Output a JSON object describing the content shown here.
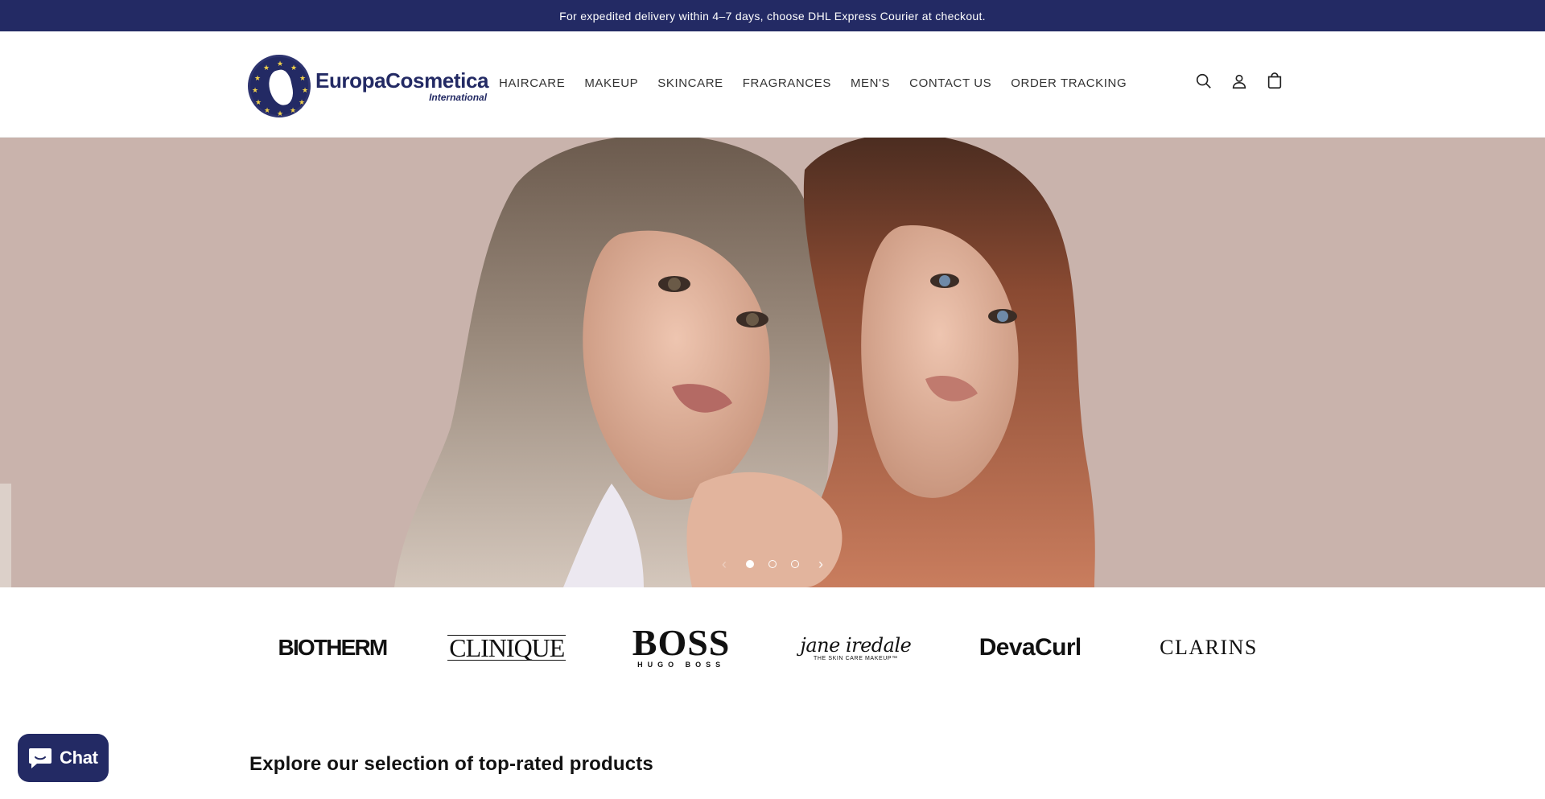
{
  "announcement": "For expedited delivery within 4–7 days, choose DHL Express Courier at checkout.",
  "logo": {
    "name": "EuropaCosmetica",
    "sub": "International"
  },
  "nav": [
    {
      "label": "HAIRCARE"
    },
    {
      "label": "MAKEUP"
    },
    {
      "label": "SKINCARE"
    },
    {
      "label": "FRAGRANCES"
    },
    {
      "label": "MEN'S"
    },
    {
      "label": "CONTACT US"
    },
    {
      "label": "ORDER TRACKING"
    }
  ],
  "header_icons": [
    "search-icon",
    "account-icon",
    "cart-icon"
  ],
  "hero": {
    "slide_count": 3,
    "active_slide": 1,
    "background_color": "#c9b3ac"
  },
  "brands": {
    "biotherm": "BIOTHERM",
    "clinique": "CLINIQUE",
    "boss": "BOSS",
    "boss_sub": "HUGO BOSS",
    "jane": "jane iredale",
    "jane_sub": "THE SKIN CARE MAKEUP™",
    "devacurl": "DevaCurl",
    "clarins": "CLARINS"
  },
  "section": {
    "title": "Explore our selection of top-rated products"
  },
  "chat": {
    "label": "Chat"
  },
  "colors": {
    "brand_navy": "#232a64",
    "hero_bg": "#c9b3ac"
  }
}
